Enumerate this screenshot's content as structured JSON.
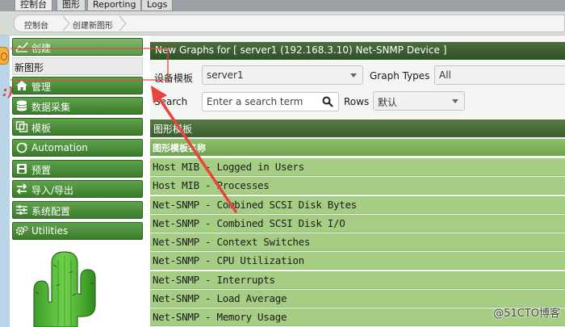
{
  "top_tabs": [
    {
      "label": "控制台"
    },
    {
      "label": "图形"
    },
    {
      "label": "Reporting"
    },
    {
      "label": "Logs"
    }
  ],
  "breadcrumb": [
    "控制台",
    "创建新图形"
  ],
  "nav": {
    "section_create": {
      "label": "创建",
      "icon": "chart-icon"
    },
    "sub_new_graphs": {
      "label": "新图形"
    },
    "items": [
      {
        "label": "管理",
        "icon": "home-icon"
      },
      {
        "label": "数据采集",
        "icon": "database-icon"
      },
      {
        "label": "模板",
        "icon": "template-icon"
      },
      {
        "label": "Automation",
        "icon": "automation-icon"
      },
      {
        "label": "预置",
        "icon": "preset-icon"
      },
      {
        "label": "导入/导出",
        "icon": "import-export-icon"
      },
      {
        "label": "系统配置",
        "icon": "settings-sliders-icon"
      },
      {
        "label": "Utilities",
        "icon": "gears-icon"
      }
    ]
  },
  "main": {
    "title": "New Graphs for [ server1 (192.168.3.10) Net-SNMP Device ]",
    "device_template_label": "设备模板",
    "device_template_value": "server1",
    "graph_types_label": "Graph Types",
    "graph_types_value": "All",
    "search_label": "Search",
    "search_placeholder": "Enter a search term",
    "rows_label": "Rows",
    "rows_value": "默认",
    "table_header": "图形模板",
    "column_header": "图形模板名称",
    "rows": [
      "Host MIB - Logged in Users",
      "Host MIB - Processes",
      "Net-SNMP - Combined SCSI Disk Bytes",
      "Net-SNMP - Combined SCSI Disk I/O",
      "Net-SNMP - Context Switches",
      "Net-SNMP - CPU Utilization",
      "Net-SNMP - Interrupts",
      "Net-SNMP - Load Average",
      "Net-SNMP - Memory Usage"
    ]
  },
  "watermark": "@51CTO博客",
  "colors": {
    "nav_green": "#3a7c2b",
    "title_green": "#2f4f25",
    "row_green": "#a6cd84",
    "annotation_red": "#e8453c"
  }
}
